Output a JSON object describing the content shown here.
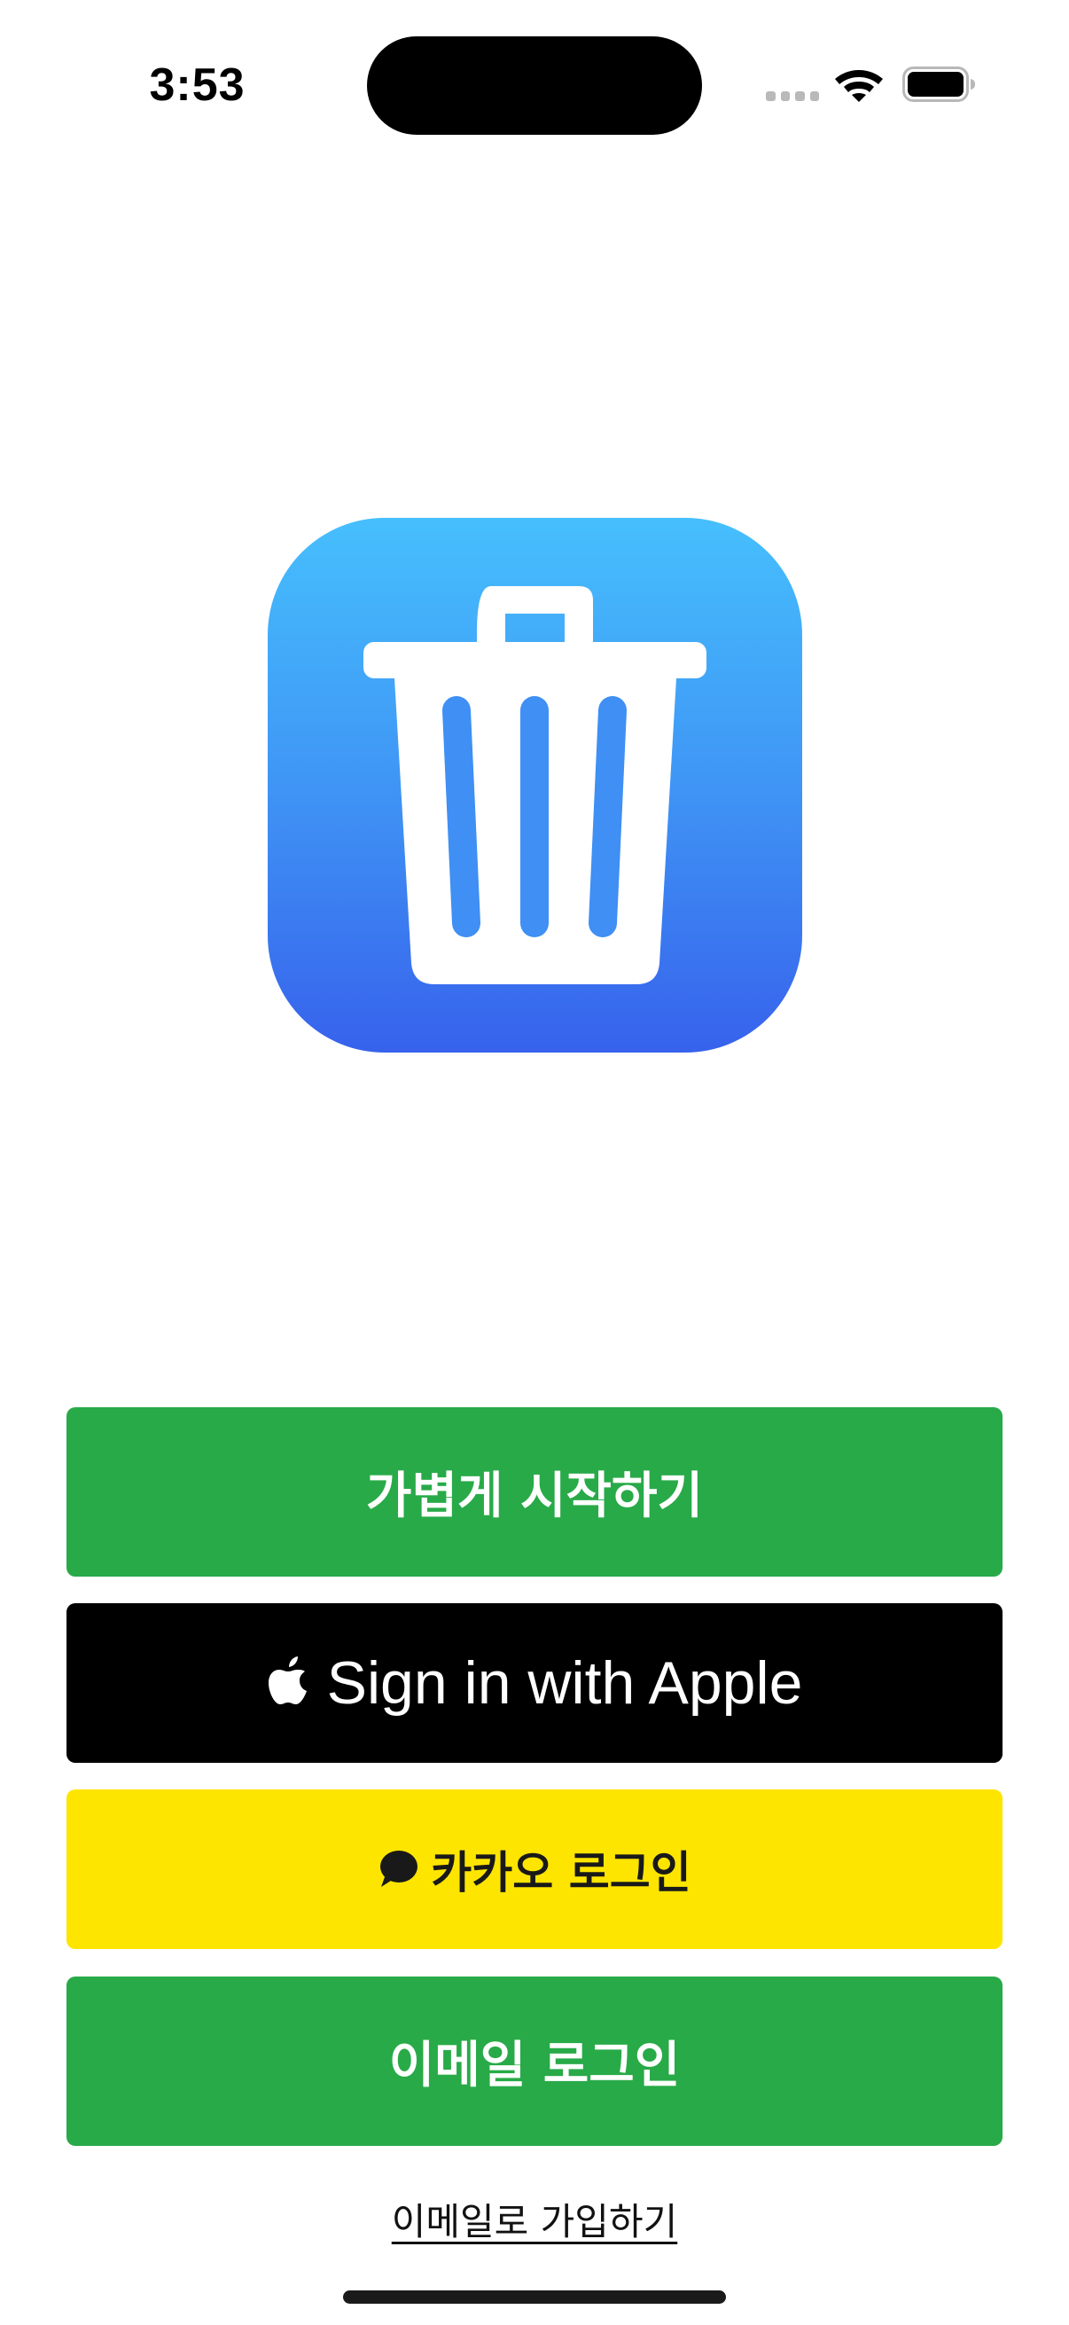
{
  "status_bar": {
    "time": "3:53"
  },
  "app_icon": {
    "name": "trash-can-icon",
    "gradient_top": "#46bffd",
    "gradient_bottom": "#3762ec"
  },
  "buttons": {
    "guest_start": {
      "label": "가볍게 시작하기",
      "color": "#28aa48"
    },
    "apple_sign_in": {
      "label": "Sign in with Apple",
      "icon": "apple-icon",
      "color": "#000000"
    },
    "kakao_login": {
      "label": "카카오 로그인",
      "icon": "kakao-talk-bubble-icon",
      "color": "#fee500"
    },
    "email_login": {
      "label": "이메일 로그인",
      "color": "#28aa48"
    }
  },
  "signup_link": {
    "label": "이메일로 가입하기"
  }
}
